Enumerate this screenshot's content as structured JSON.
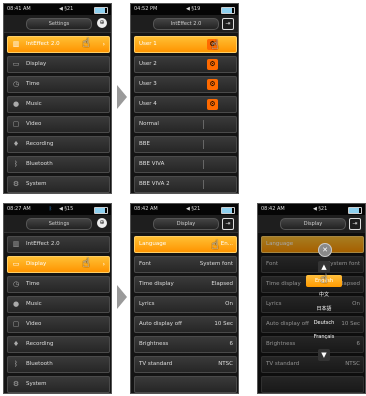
{
  "screens": [
    {
      "time": "08:41 AM",
      "volume": "◀ §21",
      "title": "Settings",
      "items": [
        {
          "label": "IntEffect 2.0",
          "icon": "equalizer-icon",
          "selected": true
        },
        {
          "label": "Display",
          "icon": "monitor-icon"
        },
        {
          "label": "Time",
          "icon": "clock-icon"
        },
        {
          "label": "Music",
          "icon": "music-disc-icon"
        },
        {
          "label": "Video",
          "icon": "tv-icon"
        },
        {
          "label": "Recording",
          "icon": "microphone-icon"
        },
        {
          "label": "Bluetooth",
          "icon": "bluetooth-icon"
        },
        {
          "label": "System",
          "icon": "gear-icon"
        }
      ]
    },
    {
      "time": "04:52 PM",
      "volume": "◀ §19",
      "title": "IntEffect 2.0",
      "items": [
        {
          "label": "User 1",
          "selected": true,
          "gear": true
        },
        {
          "label": "User 2",
          "gear": true
        },
        {
          "label": "User 3",
          "gear": true
        },
        {
          "label": "User 4",
          "gear": true
        },
        {
          "label": "Normal"
        },
        {
          "label": "BBE"
        },
        {
          "label": "BBE VIVA"
        },
        {
          "label": "BBE VIVA 2"
        }
      ]
    },
    {
      "time": "08:27 AM",
      "volume": "◀ §15",
      "title": "Settings",
      "items": [
        {
          "label": "IntEffect 2.0",
          "icon": "equalizer-icon"
        },
        {
          "label": "Display",
          "icon": "monitor-icon",
          "selected": true
        },
        {
          "label": "Time",
          "icon": "clock-icon"
        },
        {
          "label": "Music",
          "icon": "music-disc-icon"
        },
        {
          "label": "Video",
          "icon": "tv-icon"
        },
        {
          "label": "Recording",
          "icon": "microphone-icon"
        },
        {
          "label": "Bluetooth",
          "icon": "bluetooth-icon"
        },
        {
          "label": "System",
          "icon": "gear-icon"
        }
      ]
    },
    {
      "time": "08:42 AM",
      "volume": "◀ §21",
      "title": "Display",
      "items": [
        {
          "label": "Language",
          "value": "En...",
          "selected": true
        },
        {
          "label": "Font",
          "value": "System font"
        },
        {
          "label": "Time display",
          "value": "Elapsed"
        },
        {
          "label": "Lyrics",
          "value": "On"
        },
        {
          "label": "Auto display off",
          "value": "10 Sec"
        },
        {
          "label": "Brightness",
          "value": "6"
        },
        {
          "label": "TV standard",
          "value": "NTSC"
        },
        {
          "label": "",
          "value": ""
        }
      ]
    },
    {
      "time": "08:42 AM",
      "volume": "◀ §21",
      "title": "Display",
      "items": [
        {
          "label": "Language",
          "value": "",
          "selected": true
        },
        {
          "label": "Font",
          "value": "System font"
        },
        {
          "label": "Time display",
          "value": "Elapsed"
        },
        {
          "label": "Lyrics",
          "value": "On"
        },
        {
          "label": "Auto display off",
          "value": "10 Sec"
        },
        {
          "label": "Brightness",
          "value": "6"
        },
        {
          "label": "TV standard",
          "value": "NTSC"
        },
        {
          "label": "",
          "value": ""
        }
      ],
      "popup": {
        "options": [
          "English",
          "中文",
          "日本語",
          "Deutsch",
          "Français"
        ]
      }
    }
  ],
  "colors": {
    "accent": "#ff9a00",
    "gear": "#ff6a00"
  }
}
